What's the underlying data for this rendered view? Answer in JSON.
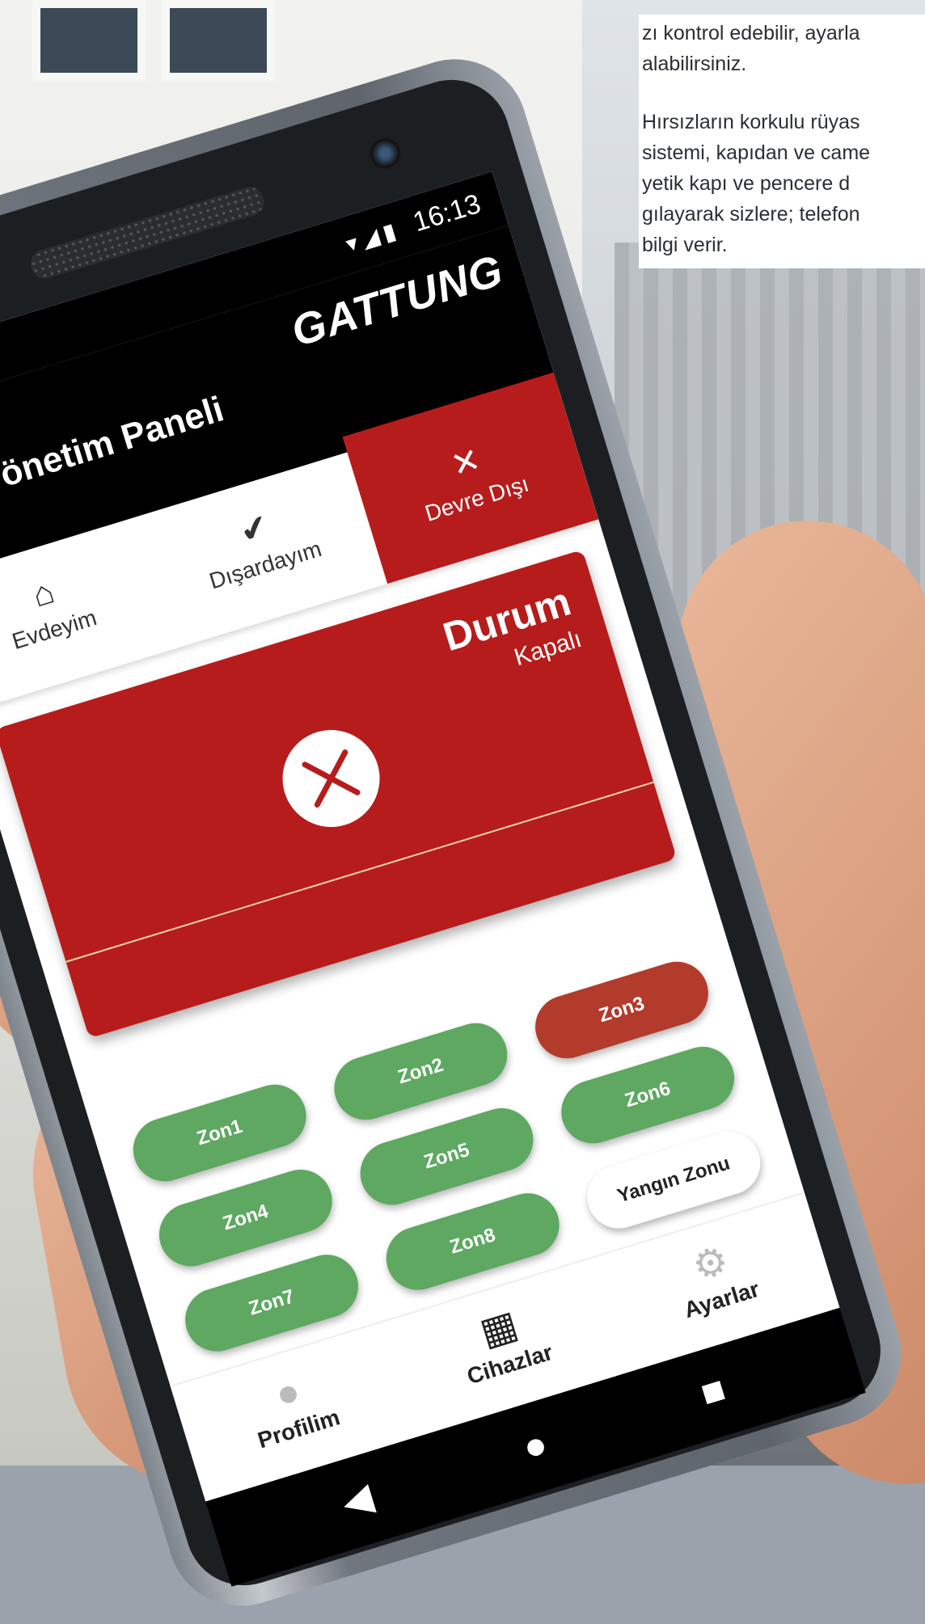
{
  "marketing_text": {
    "line1": "zı kontrol edebilir, ayarla",
    "line2": "alabilirsiniz.",
    "line3": "Hırsızların korkulu rüyas",
    "line4": "sistemi, kapıdan ve came",
    "line5": "yetik kapı ve pencere d",
    "line6": "gılayarak sizlere; telefon",
    "line7": "bilgi verir."
  },
  "status_bar": {
    "time": "16:13",
    "signal_icons": "▾◢▮"
  },
  "app_bar": {
    "title": "Yönetim Paneli",
    "brand": "GATTUNG"
  },
  "modes": [
    {
      "label": "Evdeyim",
      "icon": "home-icon"
    },
    {
      "label": "Dışardayım",
      "icon": "shield-check-icon"
    },
    {
      "label": "Devre Dışı",
      "icon": "close-icon"
    }
  ],
  "active_mode": "Devre Dışı",
  "status_card": {
    "title": "Durum",
    "subtitle": "Kapalı",
    "icon": "close-circle-icon"
  },
  "zones": [
    {
      "label": "Zon1",
      "state": "ok"
    },
    {
      "label": "Zon2",
      "state": "ok"
    },
    {
      "label": "Zon3",
      "state": "alarm"
    },
    {
      "label": "Zon4",
      "state": "ok"
    },
    {
      "label": "Zon5",
      "state": "ok"
    },
    {
      "label": "Zon6",
      "state": "ok"
    },
    {
      "label": "Zon7",
      "state": "ok"
    },
    {
      "label": "Zon8",
      "state": "ok"
    },
    {
      "label": "Yangın Zonu",
      "state": "fire"
    }
  ],
  "bottom_nav": [
    {
      "label": "Profilim",
      "icon": "person-icon"
    },
    {
      "label": "Cihazlar",
      "icon": "grid-icon"
    },
    {
      "label": "Ayarlar",
      "icon": "gear-icon"
    }
  ],
  "colors": {
    "accent_red": "#b71c1c",
    "zone_ok": "#5ea861",
    "zone_alarm": "#b23b2b",
    "brand_yellow": "#f4c20d"
  }
}
